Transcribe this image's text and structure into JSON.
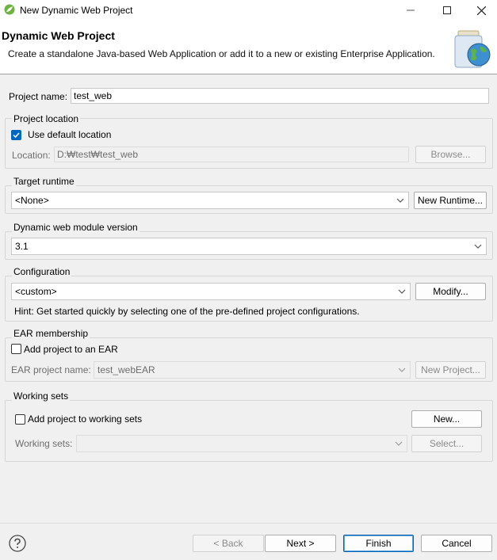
{
  "window": {
    "title": "New Dynamic Web Project",
    "minimize_glyph": "—",
    "maximize_glyph": "☐",
    "close_glyph": "✕"
  },
  "banner": {
    "title": "Dynamic Web Project",
    "description": "Create a standalone Java-based Web Application or add it to a new or existing Enterprise Application."
  },
  "project_name": {
    "label": "Project name:",
    "value": "test_web"
  },
  "project_location": {
    "group_label": "Project location",
    "use_default_label": "Use default location",
    "use_default_checked": true,
    "location_label": "Location:",
    "location_value": "D:₩test₩test_web",
    "browse_label": "Browse..."
  },
  "target_runtime": {
    "group_label": "Target runtime",
    "selected": "<None>",
    "new_runtime_label": "New Runtime..."
  },
  "module_version": {
    "group_label": "Dynamic web module version",
    "selected": "3.1"
  },
  "configuration": {
    "group_label": "Configuration",
    "selected": "<custom>",
    "modify_label": "Modify...",
    "hint": "Hint: Get started quickly by selecting one of the pre-defined project configurations."
  },
  "ear": {
    "group_label": "EAR membership",
    "add_label": "Add project to an EAR",
    "add_checked": false,
    "ear_name_label": "EAR project name:",
    "ear_name_value": "test_webEAR",
    "new_project_label": "New Project..."
  },
  "working_sets": {
    "group_label": "Working sets",
    "add_label": "Add project to working sets",
    "add_checked": false,
    "new_label": "New...",
    "sets_label": "Working sets:",
    "sets_value": "",
    "select_label": "Select..."
  },
  "footer": {
    "back_label": "< Back",
    "next_label": "Next >",
    "finish_label": "Finish",
    "cancel_label": "Cancel",
    "help_glyph": "?"
  },
  "colors": {
    "accent": "#0067c0",
    "primary_border": "#0063b1",
    "disabled_text": "#6d6d6d"
  },
  "icons": [
    "eclipse-spring-icon",
    "minimize-icon",
    "maximize-icon",
    "close-icon",
    "web-project-banner-icon",
    "checkbox-checked-icon",
    "chevron-down-icon",
    "help-icon"
  ]
}
